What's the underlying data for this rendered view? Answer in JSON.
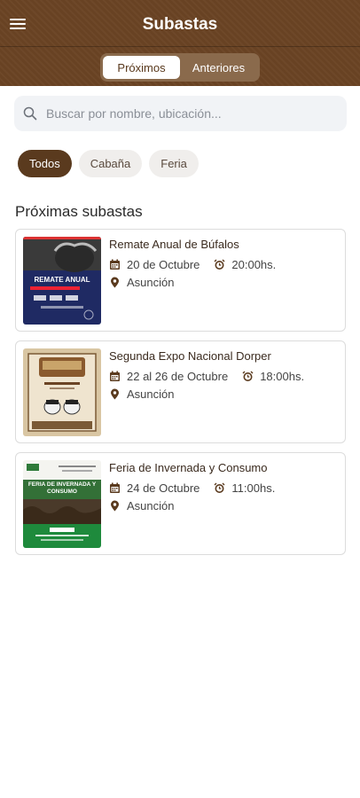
{
  "header": {
    "title": "Subastas",
    "menu_icon": "hamburger-menu-icon"
  },
  "tabs": [
    {
      "label": "Próximos",
      "active": true
    },
    {
      "label": "Anteriores",
      "active": false
    }
  ],
  "search": {
    "placeholder": "Buscar por nombre, ubicación..."
  },
  "chips": [
    {
      "label": "Todos",
      "active": true
    },
    {
      "label": "Cabaña",
      "active": false
    },
    {
      "label": "Feria",
      "active": false
    }
  ],
  "section_title": "Próximas subastas",
  "auctions": [
    {
      "title": "Remate Anual de Búfalos",
      "date": "20 de Octubre",
      "time": "20:00hs.",
      "location": "Asunción",
      "image_text": "REMATE ANUAL"
    },
    {
      "title": "Segunda Expo Nacional Dorper",
      "date": "22 al 26 de Octubre",
      "time": "18:00hs.",
      "location": "Asunción"
    },
    {
      "title": "Feria de Invernada y Consumo",
      "date": "24 de Octubre",
      "time": "11:00hs.",
      "location": "Asunción",
      "image_text": "FERIA DE INVERNADA Y CONSUMO"
    }
  ],
  "colors": {
    "brand": "#6b4424",
    "chip_active": "#5a3a1e",
    "card_border": "#dcdcdc"
  }
}
